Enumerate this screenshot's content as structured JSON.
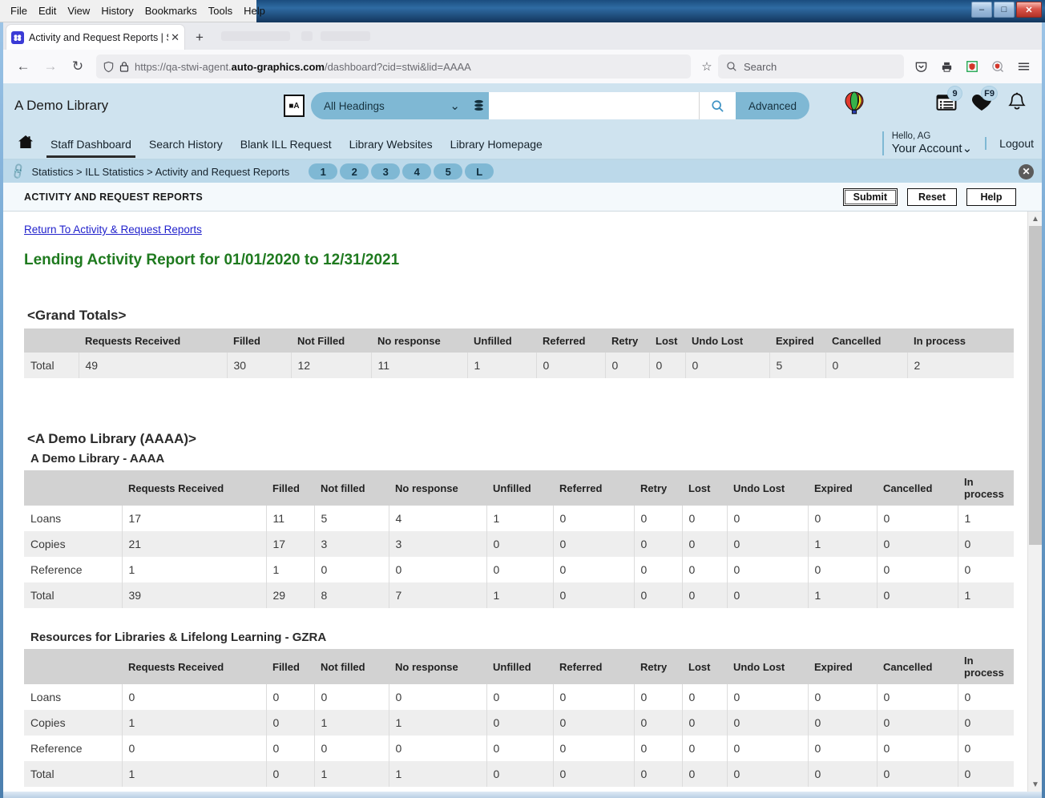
{
  "window": {
    "menus": [
      "File",
      "Edit",
      "View",
      "History",
      "Bookmarks",
      "Tools",
      "Help"
    ],
    "controls": {
      "minimize": "–",
      "maximize": "□",
      "close": "✕"
    }
  },
  "browser": {
    "tab": {
      "title": "Activity and Request Reports | S",
      "dim_suffix": "",
      "close": "✕"
    },
    "new_tab": "+",
    "back": "←",
    "forward": "→",
    "reload": "↻",
    "shield_icon": "shield",
    "lock_icon": "lock",
    "url_prefix": "https://qa-stwi-agent.",
    "url_domain": "auto-graphics.com",
    "url_suffix": "/dashboard?cid=stwi&lid=AAAA",
    "bookmark_star": "☆",
    "search_placeholder": "Search",
    "toolbar_icons": [
      "pocket-icon",
      "print-icon",
      "bitwarden-icon",
      "bitwarden-search-icon",
      "menu-icon"
    ]
  },
  "app": {
    "brand": "A Demo Library",
    "search": {
      "ocr_label": "A",
      "heading_selected": "All Headings",
      "chevron": "⌄",
      "database_icon": "database-icon",
      "query_value": "",
      "query_placeholder": "",
      "go_icon": "⌕",
      "advanced_label": "Advanced"
    },
    "balloon_icon": "🎈",
    "header_icons": [
      {
        "name": "requests-list-icon",
        "glyph": "Ὕ2",
        "badge": "9"
      },
      {
        "name": "favorites-heart-icon",
        "glyph": "♥",
        "badge": "F9"
      },
      {
        "name": "notifications-bell-icon",
        "glyph": "🔔",
        "badge": ""
      }
    ],
    "nav": {
      "home_icon": "🏠",
      "links": [
        "Staff Dashboard",
        "Search History",
        "Blank ILL Request",
        "Library Websites",
        "Library Homepage"
      ],
      "active": "Staff Dashboard",
      "greeting": "Hello, AG",
      "account": "Your Account",
      "account_chevron": "⌄",
      "logout": "Logout"
    },
    "breadcrumb": {
      "icon": "link-icon",
      "path": "Statistics > ILL Statistics > Activity and Request Reports",
      "pills": [
        "1",
        "2",
        "3",
        "4",
        "5",
        "L"
      ],
      "close": "✕"
    },
    "page": {
      "title": "ACTIVITY AND REQUEST REPORTS",
      "buttons": {
        "submit": "Submit",
        "reset": "Reset",
        "help": "Help"
      }
    }
  },
  "report": {
    "return_link": "Return To Activity & Request Reports",
    "title": "Lending Activity Report for 01/01/2020 to 12/31/2021",
    "grand_totals": {
      "heading": "<Grand Totals>",
      "columns": [
        "",
        "Requests Received",
        "Filled",
        "Not Filled",
        "No response",
        "Unfilled",
        "Referred",
        "Retry",
        "Lost",
        "Undo Lost",
        "Expired",
        "Cancelled",
        "In process"
      ],
      "rows": [
        [
          "Total",
          "49",
          "30",
          "12",
          "11",
          "1",
          "0",
          "0",
          "0",
          "0",
          "5",
          "0",
          "2"
        ]
      ]
    },
    "sections": [
      {
        "heading": "<A Demo Library (AAAA)>",
        "subheading": "A Demo Library - AAAA",
        "columns": [
          "",
          "Requests Received",
          "Filled",
          "Not filled",
          "No response",
          "Unfilled",
          "Referred",
          "Retry",
          "Lost",
          "Undo Lost",
          "Expired",
          "Cancelled",
          "In process"
        ],
        "rows": [
          [
            "Loans",
            "17",
            "11",
            "5",
            "4",
            "1",
            "0",
            "0",
            "0",
            "0",
            "0",
            "0",
            "1"
          ],
          [
            "Copies",
            "21",
            "17",
            "3",
            "3",
            "0",
            "0",
            "0",
            "0",
            "0",
            "1",
            "0",
            "0"
          ],
          [
            "Reference",
            "1",
            "1",
            "0",
            "0",
            "0",
            "0",
            "0",
            "0",
            "0",
            "0",
            "0",
            "0"
          ],
          [
            "Total",
            "39",
            "29",
            "8",
            "7",
            "1",
            "0",
            "0",
            "0",
            "0",
            "1",
            "0",
            "1"
          ]
        ]
      },
      {
        "heading": "",
        "subheading": "Resources for Libraries & Lifelong Learning - GZRA",
        "columns": [
          "",
          "Requests Received",
          "Filled",
          "Not filled",
          "No response",
          "Unfilled",
          "Referred",
          "Retry",
          "Lost",
          "Undo Lost",
          "Expired",
          "Cancelled",
          "In process"
        ],
        "rows": [
          [
            "Loans",
            "0",
            "0",
            "0",
            "0",
            "0",
            "0",
            "0",
            "0",
            "0",
            "0",
            "0",
            "0"
          ],
          [
            "Copies",
            "1",
            "0",
            "1",
            "1",
            "0",
            "0",
            "0",
            "0",
            "0",
            "0",
            "0",
            "0"
          ],
          [
            "Reference",
            "0",
            "0",
            "0",
            "0",
            "0",
            "0",
            "0",
            "0",
            "0",
            "0",
            "0",
            "0"
          ],
          [
            "Total",
            "1",
            "0",
            "1",
            "1",
            "0",
            "0",
            "0",
            "0",
            "0",
            "0",
            "0",
            "0"
          ]
        ]
      }
    ]
  },
  "colors": {
    "app_header_bg": "#cfe3ef",
    "accent": "#7fb8d4",
    "breadcrumb_bg": "#bcd9ea",
    "report_title": "#1f7a1f",
    "link": "#2222cc",
    "table_header_bg": "#d2d2d2",
    "row_alt_bg": "#eeeeee"
  }
}
